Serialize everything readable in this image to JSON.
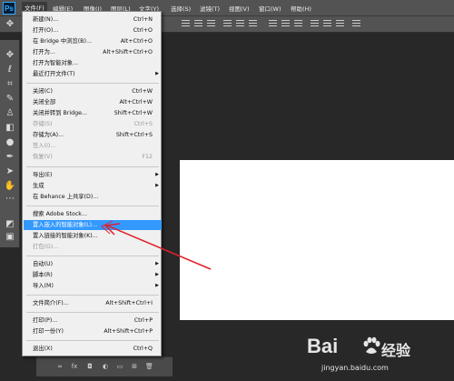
{
  "app": {
    "logo_text": "Ps"
  },
  "menubar": {
    "items": [
      "文件(F)",
      "编辑(E)",
      "图像(I)",
      "图层(L)",
      "文字(Y)",
      "选择(S)",
      "滤镜(T)",
      "视图(V)",
      "窗口(W)",
      "帮助(H)"
    ]
  },
  "file_menu": {
    "items": [
      {
        "label": "新建(N)...",
        "shortcut": "Ctrl+N"
      },
      {
        "label": "打开(O)...",
        "shortcut": "Ctrl+O"
      },
      {
        "label": "在 Bridge 中浏览(B)...",
        "shortcut": "Alt+Ctrl+O"
      },
      {
        "label": "打开为...",
        "shortcut": "Alt+Shift+Ctrl+O"
      },
      {
        "label": "打开为智能对象...",
        "shortcut": ""
      },
      {
        "label": "最近打开文件(T)",
        "shortcut": ""
      },
      {
        "label": "关闭(C)",
        "shortcut": "Ctrl+W"
      },
      {
        "label": "关闭全部",
        "shortcut": "Alt+Ctrl+W"
      },
      {
        "label": "关闭并转到 Bridge...",
        "shortcut": "Shift+Ctrl+W"
      },
      {
        "label": "存储(S)",
        "shortcut": "Ctrl+S"
      },
      {
        "label": "存储为(A)...",
        "shortcut": "Shift+Ctrl+S"
      },
      {
        "label": "签入(I)...",
        "shortcut": ""
      },
      {
        "label": "恢复(V)",
        "shortcut": "F12"
      },
      {
        "label": "导出(E)",
        "shortcut": ""
      },
      {
        "label": "生成",
        "shortcut": ""
      },
      {
        "label": "在 Behance 上共享(D)...",
        "shortcut": ""
      },
      {
        "label": "搜索 Adobe Stock...",
        "shortcut": ""
      },
      {
        "label": "置入嵌入的智能对象(L)...",
        "shortcut": ""
      },
      {
        "label": "置入链接的智能对象(K)...",
        "shortcut": ""
      },
      {
        "label": "打包(G)...",
        "shortcut": ""
      },
      {
        "label": "自动(U)",
        "shortcut": ""
      },
      {
        "label": "脚本(R)",
        "shortcut": ""
      },
      {
        "label": "导入(M)",
        "shortcut": ""
      },
      {
        "label": "文件简介(F)...",
        "shortcut": "Alt+Shift+Ctrl+I"
      },
      {
        "label": "打印(P)...",
        "shortcut": "Ctrl+P"
      },
      {
        "label": "打印一份(Y)",
        "shortcut": "Alt+Shift+Ctrl+P"
      },
      {
        "label": "退出(X)",
        "shortcut": "Ctrl+Q"
      }
    ]
  },
  "watermark": {
    "brand": "Bai",
    "brand_suffix": "经验",
    "url": "jingyan.baidu.com"
  },
  "colors": {
    "menu_highlight": "#3399ff",
    "annotation_arrow": "#e0202a",
    "canvas": "#ffffff"
  }
}
